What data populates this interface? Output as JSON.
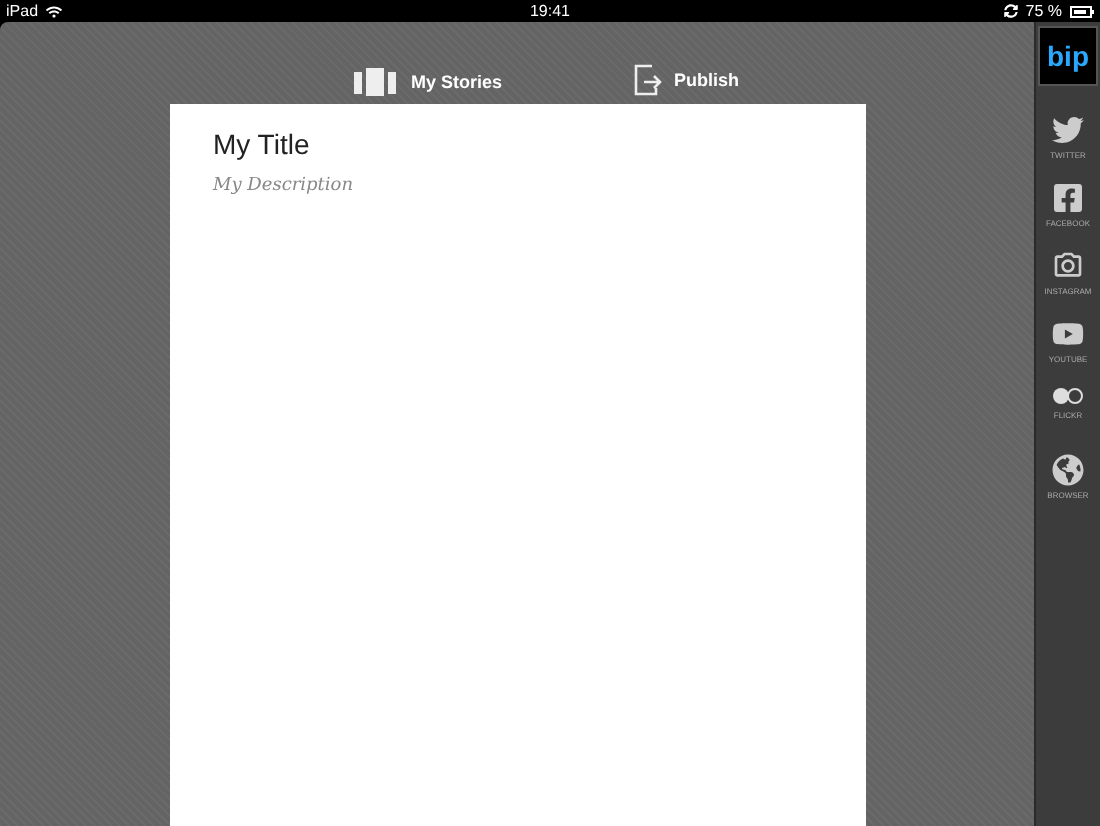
{
  "status_bar": {
    "device": "iPad",
    "time": "19:41",
    "battery": "75 %"
  },
  "toolbar": [
    "My Stories",
    "Publish"
  ],
  "document": {
    "title": "My Title",
    "description": "My Description"
  },
  "sidebar": {
    "logo": "bip",
    "items": [
      {
        "kind": "twitter",
        "label": "TWITTER"
      },
      {
        "kind": "facebook",
        "label": "FACEBOOK"
      },
      {
        "kind": "instagram",
        "label": "INSTAGRAM"
      },
      {
        "kind": "youtube",
        "label": "YOUTUBE"
      },
      {
        "kind": "flickr",
        "label": "FLICKR"
      },
      {
        "kind": "browser",
        "label": "BROWSER"
      }
    ]
  }
}
